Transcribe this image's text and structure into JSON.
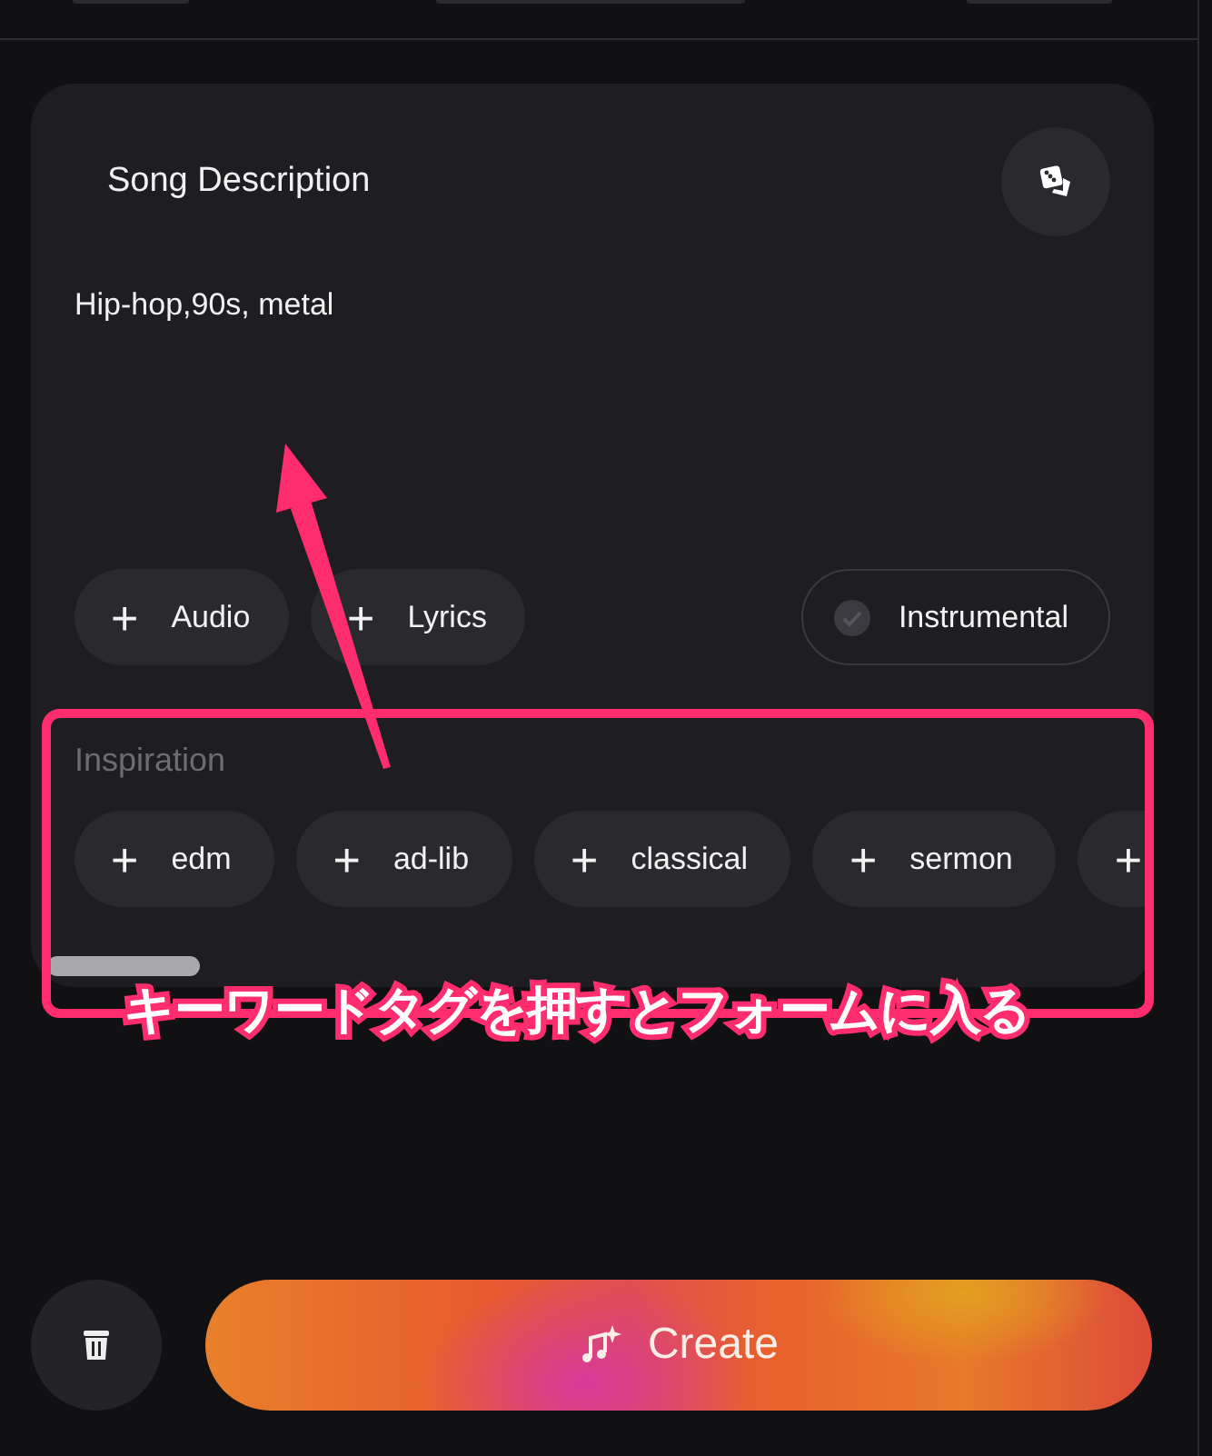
{
  "form": {
    "title": "Song Description",
    "description": "Hip-hop,90s, metal",
    "add_buttons": [
      {
        "plus": "+",
        "label": "Audio"
      },
      {
        "plus": "+",
        "label": "Lyrics"
      }
    ],
    "instrumental": {
      "label": "Instrumental",
      "on": false
    },
    "inspiration": {
      "label": "Inspiration",
      "tags": [
        {
          "plus": "+",
          "label": "edm"
        },
        {
          "plus": "+",
          "label": "ad-lib"
        },
        {
          "plus": "+",
          "label": "classical"
        },
        {
          "plus": "+",
          "label": "sermon"
        },
        {
          "plus": "+"
        }
      ]
    }
  },
  "actions": {
    "create": "Create"
  },
  "annotation": {
    "caption": "キーワードタグを押すとフォームに入る"
  }
}
